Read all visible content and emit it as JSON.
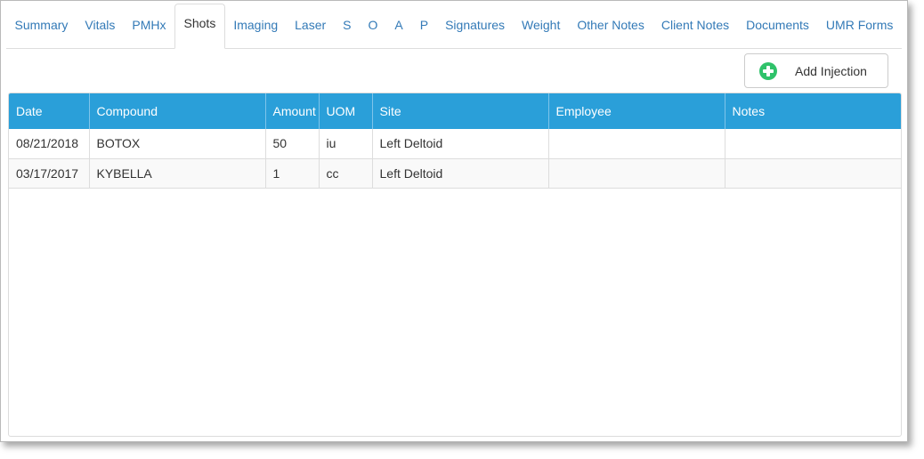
{
  "tabs": [
    {
      "label": "Summary",
      "active": false
    },
    {
      "label": "Vitals",
      "active": false
    },
    {
      "label": "PMHx",
      "active": false
    },
    {
      "label": "Shots",
      "active": true
    },
    {
      "label": "Imaging",
      "active": false
    },
    {
      "label": "Laser",
      "active": false
    },
    {
      "label": "S",
      "active": false
    },
    {
      "label": "O",
      "active": false
    },
    {
      "label": "A",
      "active": false
    },
    {
      "label": "P",
      "active": false
    },
    {
      "label": "Signatures",
      "active": false
    },
    {
      "label": "Weight",
      "active": false
    },
    {
      "label": "Other Notes",
      "active": false
    },
    {
      "label": "Client Notes",
      "active": false
    },
    {
      "label": "Documents",
      "active": false
    },
    {
      "label": "UMR Forms",
      "active": false
    }
  ],
  "toolbar": {
    "add_label": "Add Injection",
    "add_icon": "plus-circle-icon",
    "add_icon_color": "#2fc26a"
  },
  "table": {
    "header_color": "#2a9fd9",
    "columns": [
      "Date",
      "Compound",
      "Amount",
      "UOM",
      "Site",
      "Employee",
      "Notes"
    ],
    "rows": [
      [
        "08/21/2018",
        "BOTOX",
        "50",
        "iu",
        "Left Deltoid",
        "",
        ""
      ],
      [
        "03/17/2017",
        "KYBELLA",
        "1",
        "cc",
        "Left Deltoid",
        "",
        ""
      ]
    ]
  }
}
